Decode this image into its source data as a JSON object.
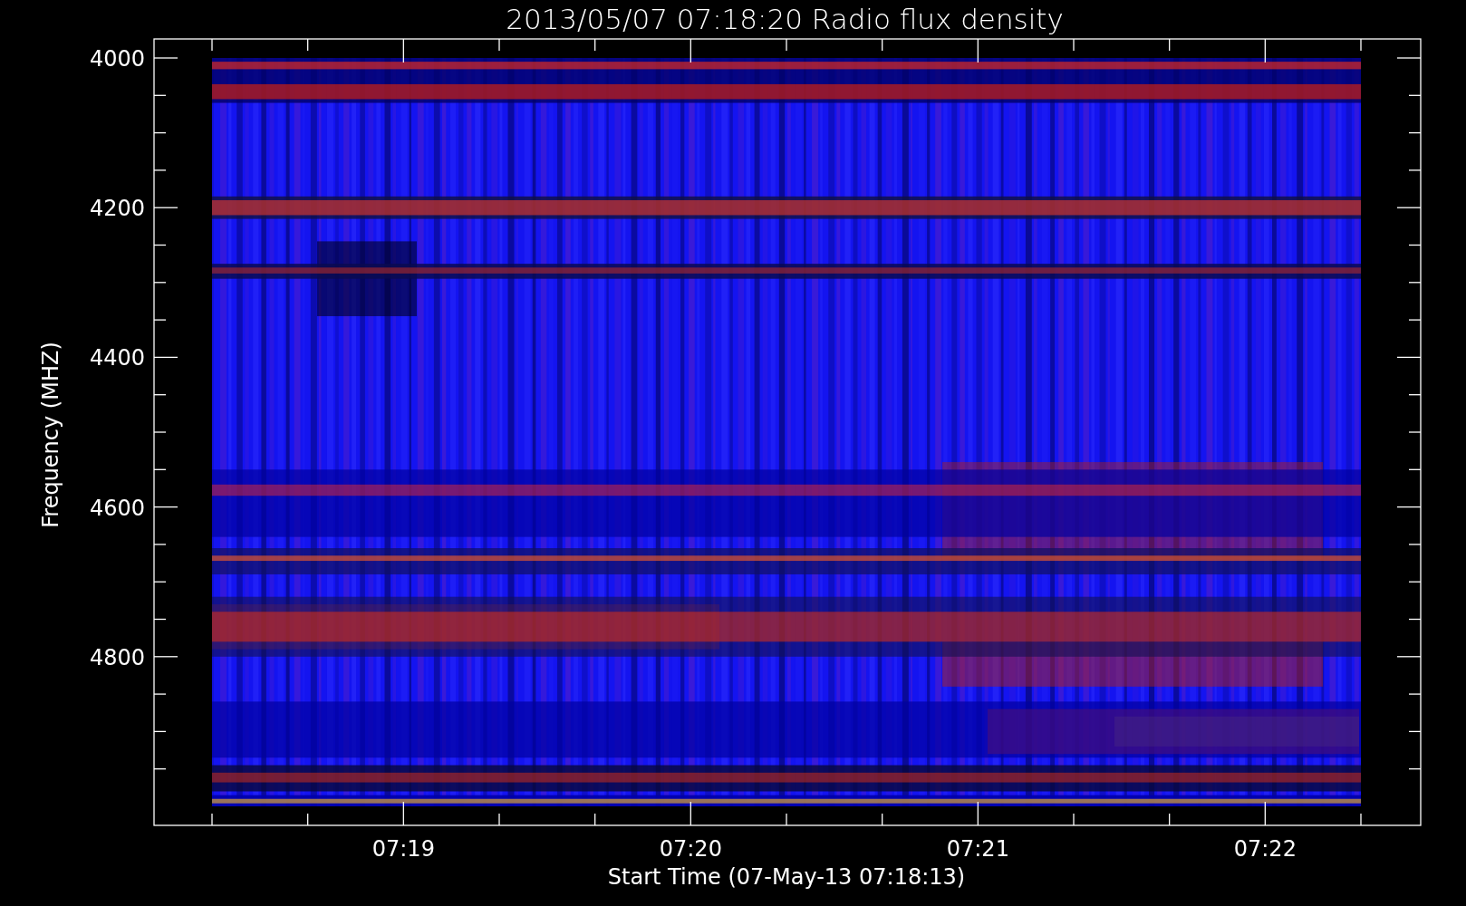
{
  "title": "2013/05/07 07:18:20 Radio flux density",
  "y_axis": {
    "label": "Frequency (MHZ)",
    "ticks": [
      "4000",
      "4200",
      "4400",
      "4600",
      "4800"
    ]
  },
  "x_axis": {
    "label": "Start Time (07-May-13 07:18:13)",
    "ticks": [
      "07:19",
      "07:20",
      "07:21",
      "07:22"
    ]
  }
}
